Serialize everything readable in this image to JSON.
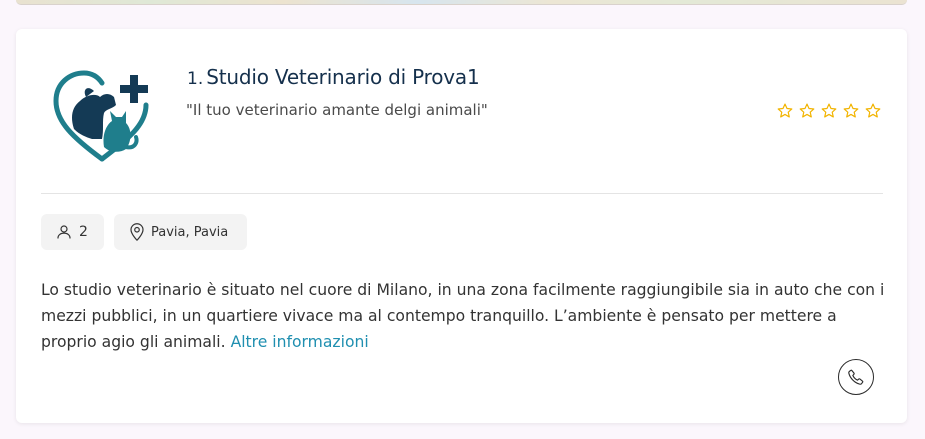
{
  "map": {
    "description_visible": false
  },
  "listing": {
    "index": "1.",
    "name": "Studio Veterinario di Prova1",
    "tagline": "\"Il tuo veterinario amante delgi animali\"",
    "rating": 0,
    "rating_max": 5,
    "staff_count": "2",
    "location": "Pavia, Pavia",
    "description": "Lo studio veterinario è situato nel cuore di Milano, in una zona facilmente raggiungibile sia in auto che con i mezzi pubblici, in un quartiere vivace ma al contempo tranquillo. L’ambiente è pensato per mettere a proprio agio gli animali.",
    "more_link": "Altre informazioni"
  },
  "icons": {
    "logo": "vet-logo-icon",
    "staff": "user-icon",
    "location": "map-pin-icon",
    "phone": "phone-icon",
    "star": "star-outline-icon"
  },
  "colors": {
    "title": "#15304c",
    "logo_teal": "#1f7e8c",
    "logo_navy": "#143a55",
    "star": "#f2b400",
    "link": "#1f8fb0"
  }
}
